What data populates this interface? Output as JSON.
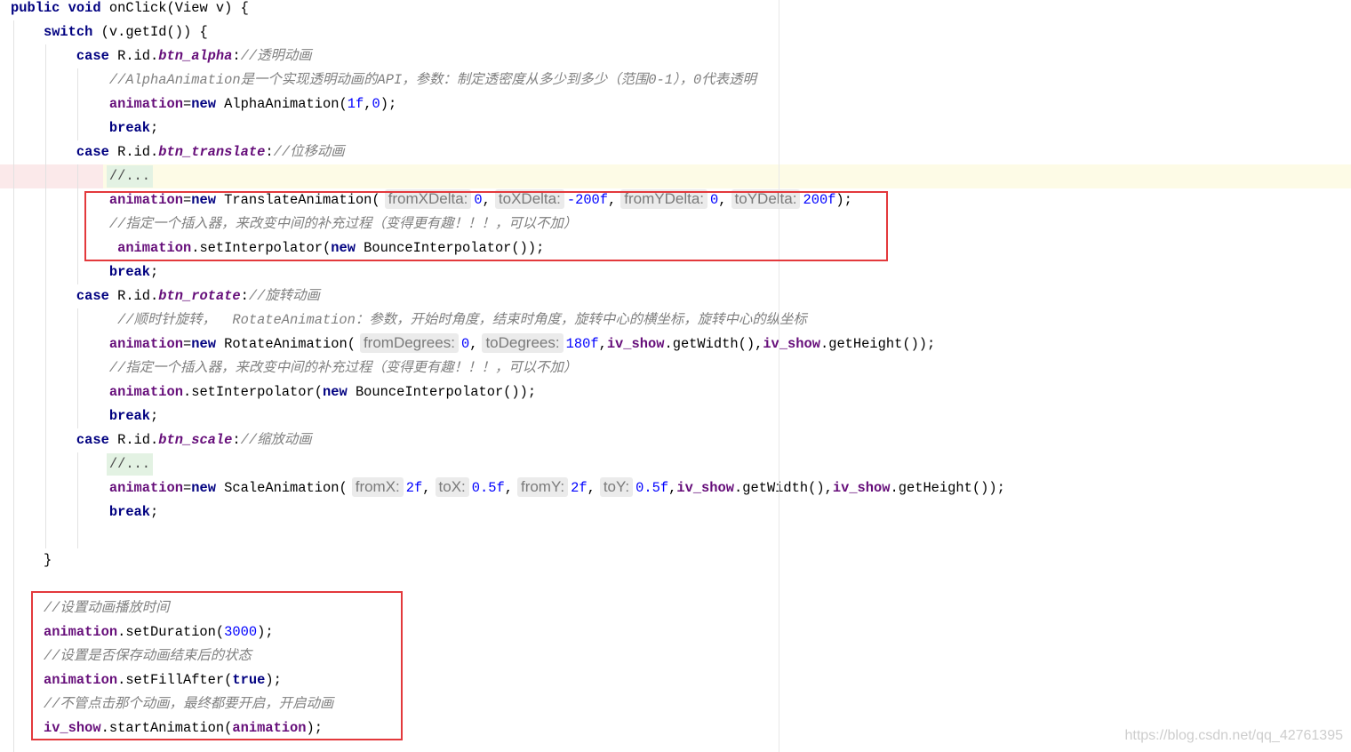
{
  "editor": {
    "lines": [
      {
        "tokens": [
          {
            "kw": "public"
          },
          {
            "plain": " "
          },
          {
            "kw": "void"
          },
          {
            "plain": " onClick(View v) {"
          }
        ]
      },
      {
        "tokens": [
          {
            "plain": "    "
          },
          {
            "kw": "switch"
          },
          {
            "plain": " (v.getId()) {"
          }
        ]
      },
      {
        "tokens": [
          {
            "plain": "        "
          },
          {
            "kw": "case"
          },
          {
            "plain": " R.id."
          },
          {
            "static": "btn_alpha"
          },
          {
            "plain": ":"
          },
          {
            "comment": "//透明动画"
          }
        ]
      },
      {
        "tokens": [
          {
            "plain": "            "
          },
          {
            "comment": "//AlphaAnimation是一个实现透明动画的API，参数：制定透密度从多少到多少（范围0-1），0代表透明"
          }
        ]
      },
      {
        "tokens": [
          {
            "plain": "            "
          },
          {
            "field": "animation"
          },
          {
            "plain": "="
          },
          {
            "kw": "new"
          },
          {
            "plain": " AlphaAnimation("
          },
          {
            "num": "1f"
          },
          {
            "plain": ","
          },
          {
            "num": "0"
          },
          {
            "plain": ");"
          }
        ]
      },
      {
        "tokens": [
          {
            "plain": "            "
          },
          {
            "kw": "break"
          },
          {
            "plain": ";"
          }
        ]
      },
      {
        "tokens": [
          {
            "plain": "        "
          },
          {
            "kw": "case"
          },
          {
            "plain": " R.id."
          },
          {
            "static": "btn_translate"
          },
          {
            "plain": ":"
          },
          {
            "comment": "//位移动画"
          }
        ]
      },
      {
        "current": true,
        "tokens": [
          {
            "plain": "            "
          },
          {
            "fold": "//..."
          }
        ]
      },
      {
        "tokens": [
          {
            "plain": "            "
          },
          {
            "field": "animation"
          },
          {
            "plain": "="
          },
          {
            "kw": "new"
          },
          {
            "plain": " TranslateAnimation("
          },
          {
            "hint": "fromXDelta:"
          },
          {
            "num": "0"
          },
          {
            "plain": ","
          },
          {
            "hint": "toXDelta:"
          },
          {
            "num": "-200f"
          },
          {
            "plain": ","
          },
          {
            "hint": "fromYDelta:"
          },
          {
            "num": "0"
          },
          {
            "plain": ","
          },
          {
            "hint": "toYDelta:"
          },
          {
            "num": "200f"
          },
          {
            "plain": ");"
          }
        ]
      },
      {
        "tokens": [
          {
            "plain": "            "
          },
          {
            "comment": "//指定一个插入器，来改变中间的补充过程（变得更有趣！！！，可以不加）"
          }
        ]
      },
      {
        "tokens": [
          {
            "plain": "             "
          },
          {
            "field": "animation"
          },
          {
            "plain": ".setInterpolator("
          },
          {
            "kw": "new"
          },
          {
            "plain": " BounceInterpolator());"
          }
        ]
      },
      {
        "tokens": [
          {
            "plain": "            "
          },
          {
            "kw": "break"
          },
          {
            "plain": ";"
          }
        ]
      },
      {
        "tokens": [
          {
            "plain": "        "
          },
          {
            "kw": "case"
          },
          {
            "plain": " R.id."
          },
          {
            "static": "btn_rotate"
          },
          {
            "plain": ":"
          },
          {
            "comment": "//旋转动画"
          }
        ]
      },
      {
        "tokens": [
          {
            "plain": "             "
          },
          {
            "comment": "//顺时针旋转，  RotateAnimation：参数，开始时角度，结束时角度，旋转中心的横坐标，旋转中心的纵坐标"
          }
        ]
      },
      {
        "tokens": [
          {
            "plain": "            "
          },
          {
            "field": "animation"
          },
          {
            "plain": "="
          },
          {
            "kw": "new"
          },
          {
            "plain": " RotateAnimation("
          },
          {
            "hint": "fromDegrees:"
          },
          {
            "num": "0"
          },
          {
            "plain": ","
          },
          {
            "hint": "toDegrees:"
          },
          {
            "num": "180f"
          },
          {
            "plain": ","
          },
          {
            "field": "iv_show"
          },
          {
            "plain": ".getWidth(),"
          },
          {
            "field": "iv_show"
          },
          {
            "plain": ".getHeight());"
          }
        ]
      },
      {
        "tokens": [
          {
            "plain": "            "
          },
          {
            "comment": "//指定一个插入器，来改变中间的补充过程（变得更有趣！！！，可以不加）"
          }
        ]
      },
      {
        "tokens": [
          {
            "plain": "            "
          },
          {
            "field": "animation"
          },
          {
            "plain": ".setInterpolator("
          },
          {
            "kw": "new"
          },
          {
            "plain": " BounceInterpolator());"
          }
        ]
      },
      {
        "tokens": [
          {
            "plain": "            "
          },
          {
            "kw": "break"
          },
          {
            "plain": ";"
          }
        ]
      },
      {
        "tokens": [
          {
            "plain": "        "
          },
          {
            "kw": "case"
          },
          {
            "plain": " R.id."
          },
          {
            "static": "btn_scale"
          },
          {
            "plain": ":"
          },
          {
            "comment": "//缩放动画"
          }
        ]
      },
      {
        "tokens": [
          {
            "plain": "            "
          },
          {
            "fold": "//..."
          }
        ]
      },
      {
        "tokens": [
          {
            "plain": "            "
          },
          {
            "field": "animation"
          },
          {
            "plain": "="
          },
          {
            "kw": "new"
          },
          {
            "plain": " ScaleAnimation("
          },
          {
            "hint": "fromX:"
          },
          {
            "num": "2f"
          },
          {
            "plain": ","
          },
          {
            "hint": "toX:"
          },
          {
            "num": "0.5f"
          },
          {
            "plain": ","
          },
          {
            "hint": "fromY:"
          },
          {
            "num": "2f"
          },
          {
            "plain": ","
          },
          {
            "hint": "toY:"
          },
          {
            "num": "0.5f"
          },
          {
            "plain": ","
          },
          {
            "field": "iv_show"
          },
          {
            "plain": ".getWidth(),"
          },
          {
            "field": "iv_show"
          },
          {
            "plain": ".getHeight());"
          }
        ]
      },
      {
        "tokens": [
          {
            "plain": "            "
          },
          {
            "kw": "break"
          },
          {
            "plain": ";"
          }
        ]
      },
      {
        "tokens": []
      },
      {
        "tokens": [
          {
            "plain": "    }"
          }
        ]
      },
      {
        "tokens": []
      },
      {
        "tokens": [
          {
            "plain": "    "
          },
          {
            "comment": "//设置动画播放时间"
          }
        ]
      },
      {
        "tokens": [
          {
            "plain": "    "
          },
          {
            "field": "animation"
          },
          {
            "plain": ".setDuration("
          },
          {
            "num": "3000"
          },
          {
            "plain": ");"
          }
        ]
      },
      {
        "tokens": [
          {
            "plain": "    "
          },
          {
            "comment": "//设置是否保存动画结束后的状态"
          }
        ]
      },
      {
        "tokens": [
          {
            "plain": "    "
          },
          {
            "field": "animation"
          },
          {
            "plain": ".setFillAfter("
          },
          {
            "kw": "true"
          },
          {
            "plain": ");"
          }
        ]
      },
      {
        "tokens": [
          {
            "plain": "    "
          },
          {
            "comment": "//不管点击那个动画，最终都要开启，开启动画"
          }
        ]
      },
      {
        "tokens": [
          {
            "plain": "    "
          },
          {
            "field": "iv_show"
          },
          {
            "plain": ".startAnimation("
          },
          {
            "field": "animation"
          },
          {
            "plain": ");"
          }
        ]
      }
    ]
  },
  "watermark": "https://blog.csdn.net/qq_42761395",
  "syntax_colors": {
    "kw": "#000080",
    "field": "#660e7a",
    "static": "#660e7a",
    "comment": "#808080",
    "num": "#0000ff",
    "plain": "#000000",
    "hint": "#7a7a7a",
    "fold": "#4a4a4a"
  },
  "highlight_colors": {
    "current_line": "#fdfbe6",
    "fold_background": "#e3f2e3",
    "hint_background": "#ebebeb",
    "annotation_box": "#e3393c"
  }
}
